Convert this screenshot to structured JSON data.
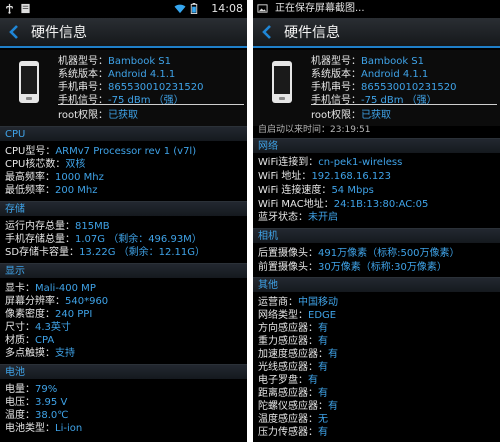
{
  "left": {
    "statusbar": {
      "time": "14:08",
      "icons": [
        "usb-icon",
        "notification-icon",
        "wifi-icon",
        "battery-icon"
      ]
    },
    "title": "硬件信息",
    "device": {
      "rows": [
        {
          "label": "机器型号：",
          "value": "Bambook S1"
        },
        {
          "label": "系统版本：",
          "value": "Android 4.1.1"
        },
        {
          "label": "手机串号：",
          "value": "865530010231520"
        },
        {
          "label": "手机信号：",
          "value": "-75 dBm （强）"
        },
        {
          "label": "root权限：",
          "value": "已获取"
        }
      ]
    },
    "sections": [
      {
        "title": "CPU",
        "rows": [
          {
            "label": "CPU型号：",
            "value": "ARMv7 Processor rev 1 (v7l)"
          },
          {
            "label": "CPU核芯数：",
            "value": "双核"
          },
          {
            "label": "最高频率：",
            "value": "1000 Mhz"
          },
          {
            "label": "最低频率：",
            "value": "200 Mhz"
          }
        ]
      },
      {
        "title": "存储",
        "rows": [
          {
            "label": "运行内存总量：",
            "value": "815MB"
          },
          {
            "label": "手机存储总量：",
            "value": "1.07G （剩余：496.93M）"
          },
          {
            "label": "SD存储卡容量：",
            "value": "13.22G （剩余：12.11G）"
          }
        ]
      },
      {
        "title": "显示",
        "rows": [
          {
            "label": "显卡：",
            "value": "Mali-400 MP"
          },
          {
            "label": "屏幕分辨率：",
            "value": "540*960"
          },
          {
            "label": "像素密度：",
            "value": "240 PPI"
          },
          {
            "label": "尺寸：",
            "value": "4.3英寸"
          },
          {
            "label": "材质：",
            "value": "CPA"
          },
          {
            "label": "多点触摸：",
            "value": "支持"
          }
        ]
      },
      {
        "title": "电池",
        "rows": [
          {
            "label": "电量：",
            "value": "79%"
          },
          {
            "label": "电压：",
            "value": "3.95 V"
          },
          {
            "label": "温度：",
            "value": "38.0℃"
          },
          {
            "label": "电池类型：",
            "value": "Li-ion"
          }
        ]
      }
    ]
  },
  "right": {
    "statusbar": {
      "text": "正在保存屏幕截图...",
      "icons": [
        "image-icon"
      ]
    },
    "title": "硬件信息",
    "device": {
      "rows": [
        {
          "label": "机器型号：",
          "value": "Bambook S1"
        },
        {
          "label": "系统版本：",
          "value": "Android 4.1.1"
        },
        {
          "label": "手机串号：",
          "value": "865530010231520"
        },
        {
          "label": "手机信号：",
          "value": "-75 dBm （强）"
        },
        {
          "label": "root权限：",
          "value": "已获取"
        }
      ]
    },
    "cut_row": "自启动以来时间：23:19:51",
    "sections": [
      {
        "title": "网络",
        "rows": [
          {
            "label": "WiFi连接到：",
            "value": "cn-pek1-wireless"
          },
          {
            "label": "WiFi 地址：",
            "value": "192.168.16.123"
          },
          {
            "label": "WiFi 连接速度：",
            "value": "54 Mbps"
          },
          {
            "label": "WiFi MAC地址：",
            "value": "24:1B:13:80:AC:05"
          },
          {
            "label": "蓝牙状态：",
            "value": "未开启"
          }
        ]
      },
      {
        "title": "相机",
        "rows": [
          {
            "label": "后置摄像头：",
            "value": "491万像素（标称:500万像素）"
          },
          {
            "label": "前置摄像头：",
            "value": "30万像素（标称:30万像素）"
          }
        ]
      },
      {
        "title": "其他",
        "rows": [
          {
            "label": "运营商：",
            "value": "中国移动"
          },
          {
            "label": "网络类型：",
            "value": "EDGE"
          },
          {
            "label": "方向感应器：",
            "value": "有"
          },
          {
            "label": "重力感应器：",
            "value": "有"
          },
          {
            "label": "加速度感应器：",
            "value": "有"
          },
          {
            "label": "光线感应器：",
            "value": "有"
          },
          {
            "label": "电子罗盘：",
            "value": "有"
          },
          {
            "label": "距离感应器：",
            "value": "有"
          },
          {
            "label": "陀螺仪感应器：",
            "value": "有"
          },
          {
            "label": "温度感应器：",
            "value": "无"
          },
          {
            "label": "压力传感器：",
            "value": "有"
          }
        ]
      }
    ]
  }
}
